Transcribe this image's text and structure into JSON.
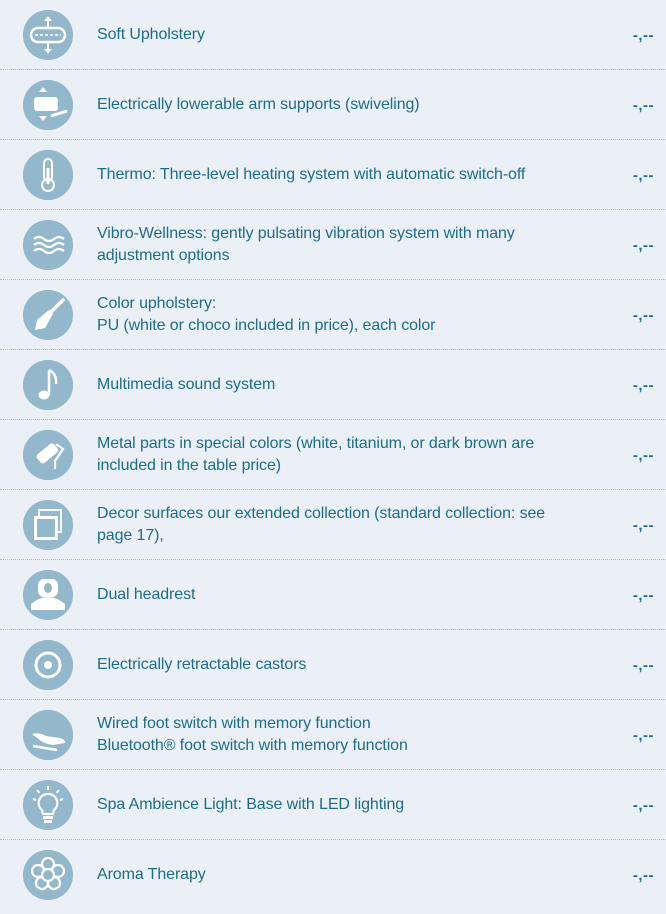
{
  "items": [
    {
      "label": "Soft Upholstery",
      "price": "-,--",
      "icon": "upholstery-icon"
    },
    {
      "label": "Electrically lowerable arm supports (swiveling)",
      "price": "-,--",
      "icon": "arm-support-icon"
    },
    {
      "label": "Thermo: Three-level heating system with automatic switch-off",
      "price": "-,--",
      "icon": "thermometer-icon"
    },
    {
      "label": "Vibro-Wellness: gently pulsating vibration system with many adjustment options",
      "price": "-,--",
      "icon": "vibration-waves-icon"
    },
    {
      "label": "Color upholstery:\nPU (white or choco included in price), each color",
      "price": "-,--",
      "icon": "paintbrush-icon"
    },
    {
      "label": "Multimedia sound system",
      "price": "-,--",
      "icon": "music-note-icon"
    },
    {
      "label": "Metal parts in special colors (white, titanium, or dark brown are included in the table price)",
      "price": "-,--",
      "icon": "paint-roller-icon"
    },
    {
      "label": "Decor surfaces  our extended collection (standard collection: see page 17),",
      "price": "-,--",
      "icon": "decor-squares-icon"
    },
    {
      "label": "Dual headrest",
      "price": "-,--",
      "icon": "headrest-icon"
    },
    {
      "label": "Electrically retractable castors",
      "price": "-,--",
      "icon": "castor-icon"
    },
    {
      "label": "Wired foot switch with memory function\nBluetooth® foot switch with memory function",
      "price": "-,--",
      "icon": "foot-switch-icon"
    },
    {
      "label": "Spa Ambience Light: Base with LED lighting",
      "price": "-,--",
      "icon": "light-bulb-icon"
    },
    {
      "label": "Aroma Therapy",
      "price": "-,--",
      "icon": "flower-icon"
    }
  ],
  "colors": {
    "text": "#1d6d88",
    "icon_bg": "#93b8cb",
    "background": "#eaf0f6"
  }
}
